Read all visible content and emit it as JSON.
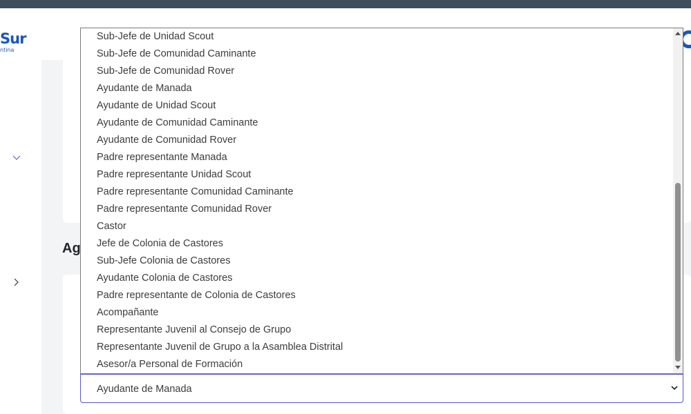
{
  "header": {
    "logo_main": "Sur",
    "logo_sub": "ntina"
  },
  "section": {
    "heading": "Ag"
  },
  "dropdown": {
    "options": [
      "Sub-Jefe de Unidad Scout",
      "Sub-Jefe de Comunidad Caminante",
      "Sub-Jefe de Comunidad Rover",
      "Ayudante de Manada",
      "Ayudante de Unidad Scout",
      "Ayudante de Comunidad Caminante",
      "Ayudante de Comunidad Rover",
      "Padre representante Manada",
      "Padre representante Unidad Scout",
      "Padre representante Comunidad Caminante",
      "Padre representante Comunidad Rover",
      "Castor",
      "Jefe de Colonia de Castores",
      "Sub-Jefe Colonia de Castores",
      "Ayudante Colonia de Castores",
      "Padre representante de Colonia de Castores",
      "Acompañante",
      "Representante Juvenil al Consejo de Grupo",
      "Representante Juvenil de Grupo a la Asamblea Distrital",
      "Asesor/a Personal de Formación"
    ],
    "selected": "Ayudante de Manada"
  },
  "colors": {
    "topbar": "#3e4d5a",
    "brand": "#1a57b8",
    "select_border": "#5555cc"
  },
  "icons": {
    "logo": "scout-logo",
    "avatar": "user-avatar-icon",
    "chevron_down": "chevron-down-icon",
    "chevron_right": "chevron-right-icon",
    "select_caret": "select-caret-icon"
  }
}
